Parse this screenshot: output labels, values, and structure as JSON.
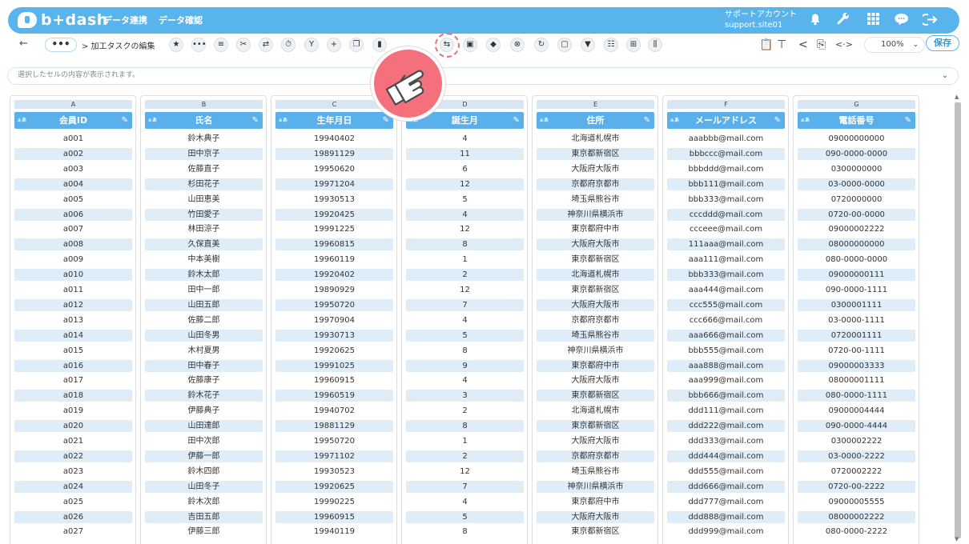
{
  "header": {
    "logo": "b+dash",
    "nav": [
      "データ連携",
      "データ確認"
    ],
    "account_name": "サポートアカウント",
    "account_id": "support.site01",
    "icons": [
      "bell-icon",
      "wrench-icon",
      "grid-icon",
      "chat-icon",
      "logout-icon"
    ]
  },
  "toolbar": {
    "back": "←",
    "more": "•••",
    "breadcrumb": "> 加工タスクの編集",
    "tools": [
      {
        "name": "star-tool",
        "glyph": "★"
      },
      {
        "name": "more-tool",
        "glyph": "•••"
      },
      {
        "name": "list-tool",
        "glyph": "≡"
      },
      {
        "name": "scissors-tool",
        "glyph": "✂"
      },
      {
        "name": "merge-tool",
        "glyph": "⇄"
      },
      {
        "name": "timer-tool",
        "glyph": "⏱"
      },
      {
        "name": "branch-tool",
        "glyph": "Y"
      },
      {
        "name": "add-tool",
        "glyph": "+"
      },
      {
        "name": "copy-tool",
        "glyph": "❐"
      },
      {
        "name": "delete-tool",
        "glyph": "▮"
      },
      {
        "name": "swap-tool",
        "glyph": "⇆"
      },
      {
        "name": "lock-tool",
        "glyph": "▣"
      },
      {
        "name": "box-tool",
        "glyph": "◆"
      },
      {
        "name": "cancel-tool",
        "glyph": "⊗"
      },
      {
        "name": "refresh-tool",
        "glyph": "↻"
      },
      {
        "name": "frame-tool",
        "glyph": "▢"
      },
      {
        "name": "filter-tool",
        "glyph": "▼"
      },
      {
        "name": "group-tool",
        "glyph": "☷"
      },
      {
        "name": "table-tool",
        "glyph": "⊞"
      },
      {
        "name": "column-tool",
        "glyph": "⫼"
      }
    ],
    "right_icons": [
      {
        "name": "clipboard-icon",
        "glyph": "📋"
      },
      {
        "name": "hierarchy-icon",
        "glyph": "⊤"
      },
      {
        "name": "share-icon",
        "glyph": "<"
      },
      {
        "name": "export-icon",
        "glyph": "⎘"
      },
      {
        "name": "code-icon",
        "glyph": "<·>"
      }
    ],
    "zoom": "100%",
    "zoom_caret": "⌄",
    "save": "保存"
  },
  "cellbar": {
    "placeholder": "選択したセルの内容が表示されます。",
    "chevron": "⌄"
  },
  "columns": [
    {
      "letter": "A",
      "type": "ａあ",
      "title": "会員ID"
    },
    {
      "letter": "B",
      "type": "ａあ",
      "title": "氏名"
    },
    {
      "letter": "C",
      "type": "ａあ",
      "title": "生年月日"
    },
    {
      "letter": "D",
      "type": "ａあ",
      "title": "誕生月"
    },
    {
      "letter": "E",
      "type": "ａあ",
      "title": "住所"
    },
    {
      "letter": "F",
      "type": "ａあ",
      "title": "メールアドレス"
    },
    {
      "letter": "G",
      "type": "ａあ",
      "title": "電話番号"
    }
  ],
  "edit_glyph": "✎",
  "rows": [
    [
      "a001",
      "鈴木典子",
      "19940402",
      "4",
      "北海道札幌市",
      "aaabbb@mail.com",
      "09000000000"
    ],
    [
      "a002",
      "田中京子",
      "19891129",
      "11",
      "東京都新宿区",
      "bbbccc@mail.com",
      "090-0000-0000"
    ],
    [
      "a003",
      "佐藤直子",
      "19950620",
      "6",
      "大阪府大阪市",
      "bbbddd@mail.com",
      "0300000000"
    ],
    [
      "a004",
      "杉田花子",
      "19971204",
      "12",
      "京都府京都市",
      "bbb111@mail.com",
      "03-0000-0000"
    ],
    [
      "a005",
      "山田恵美",
      "19930513",
      "5",
      "埼玉県熊谷市",
      "bbb333@mail.com",
      "0720000000"
    ],
    [
      "a006",
      "竹田愛子",
      "19920425",
      "4",
      "神奈川県横浜市",
      "cccddd@mail.com",
      "0720-00-0000"
    ],
    [
      "a007",
      "林田涼子",
      "19991225",
      "12",
      "東京都府中市",
      "ccceee@mail.com",
      "09000002222"
    ],
    [
      "a008",
      "久保直美",
      "19960815",
      "8",
      "大阪府大阪市",
      "111aaa@mail.com",
      "08000000000"
    ],
    [
      "a009",
      "中本美樹",
      "19960119",
      "1",
      "東京都新宿区",
      "aaa111@mail.com",
      "080-0000-0000"
    ],
    [
      "a010",
      "鈴木太郎",
      "19920402",
      "2",
      "北海道札幌市",
      "bbb333@mail.com",
      "09000000111"
    ],
    [
      "a011",
      "田中一郎",
      "19890929",
      "12",
      "東京都新宿区",
      "aaa444@mail.com",
      "090-0000-1111"
    ],
    [
      "a012",
      "山田五郎",
      "19950720",
      "7",
      "大阪府大阪市",
      "ccc555@mail.com",
      "0300001111"
    ],
    [
      "a013",
      "佐藤二郎",
      "19970904",
      "4",
      "京都府京都市",
      "ccc666@mail.com",
      "03-0000-1111"
    ],
    [
      "a014",
      "山田冬男",
      "19930713",
      "5",
      "埼玉県熊谷市",
      "aaa666@mail.com",
      "0720001111"
    ],
    [
      "a015",
      "木村夏男",
      "19920625",
      "8",
      "神奈川県横浜市",
      "bbb555@mail.com",
      "0720-00-1111"
    ],
    [
      "a016",
      "田中春子",
      "19991025",
      "9",
      "東京都府中市",
      "aaa888@mail.com",
      "09000003333"
    ],
    [
      "a017",
      "佐藤康子",
      "19960915",
      "4",
      "大阪府大阪市",
      "aaa999@mail.com",
      "08000001111"
    ],
    [
      "a018",
      "鈴木花子",
      "19960519",
      "3",
      "東京都新宿区",
      "bbb666@mail.com",
      "080-0000-1111"
    ],
    [
      "a019",
      "伊藤典子",
      "19940702",
      "2",
      "北海道札幌市",
      "ddd111@mail.com",
      "09000004444"
    ],
    [
      "a020",
      "山田達郎",
      "19881129",
      "8",
      "東京都新宿区",
      "ddd222@mail.com",
      "090-0000-4444"
    ],
    [
      "a021",
      "田中次郎",
      "19950720",
      "1",
      "大阪府大阪市",
      "ddd333@mail.com",
      "0300002222"
    ],
    [
      "a022",
      "伊藤一郎",
      "19971102",
      "2",
      "京都府京都市",
      "ddd444@mail.com",
      "03-0000-2222"
    ],
    [
      "a023",
      "鈴木四郎",
      "19930523",
      "12",
      "埼玉県熊谷市",
      "ddd555@mail.com",
      "0720002222"
    ],
    [
      "a024",
      "山田冬子",
      "19920625",
      "7",
      "神奈川県横浜市",
      "ddd666@mail.com",
      "0720-00-2222"
    ],
    [
      "a025",
      "鈴木次郎",
      "19990225",
      "4",
      "東京都府中市",
      "ddd777@mail.com",
      "09000005555"
    ],
    [
      "a026",
      "吉田五郎",
      "19960915",
      "5",
      "大阪府大阪市",
      "ddd888@mail.com",
      "08000002222"
    ],
    [
      "a027",
      "伊藤三郎",
      "19940119",
      "8",
      "東京都新宿区",
      "ddd999@mail.com",
      "080-0000-2222"
    ]
  ]
}
